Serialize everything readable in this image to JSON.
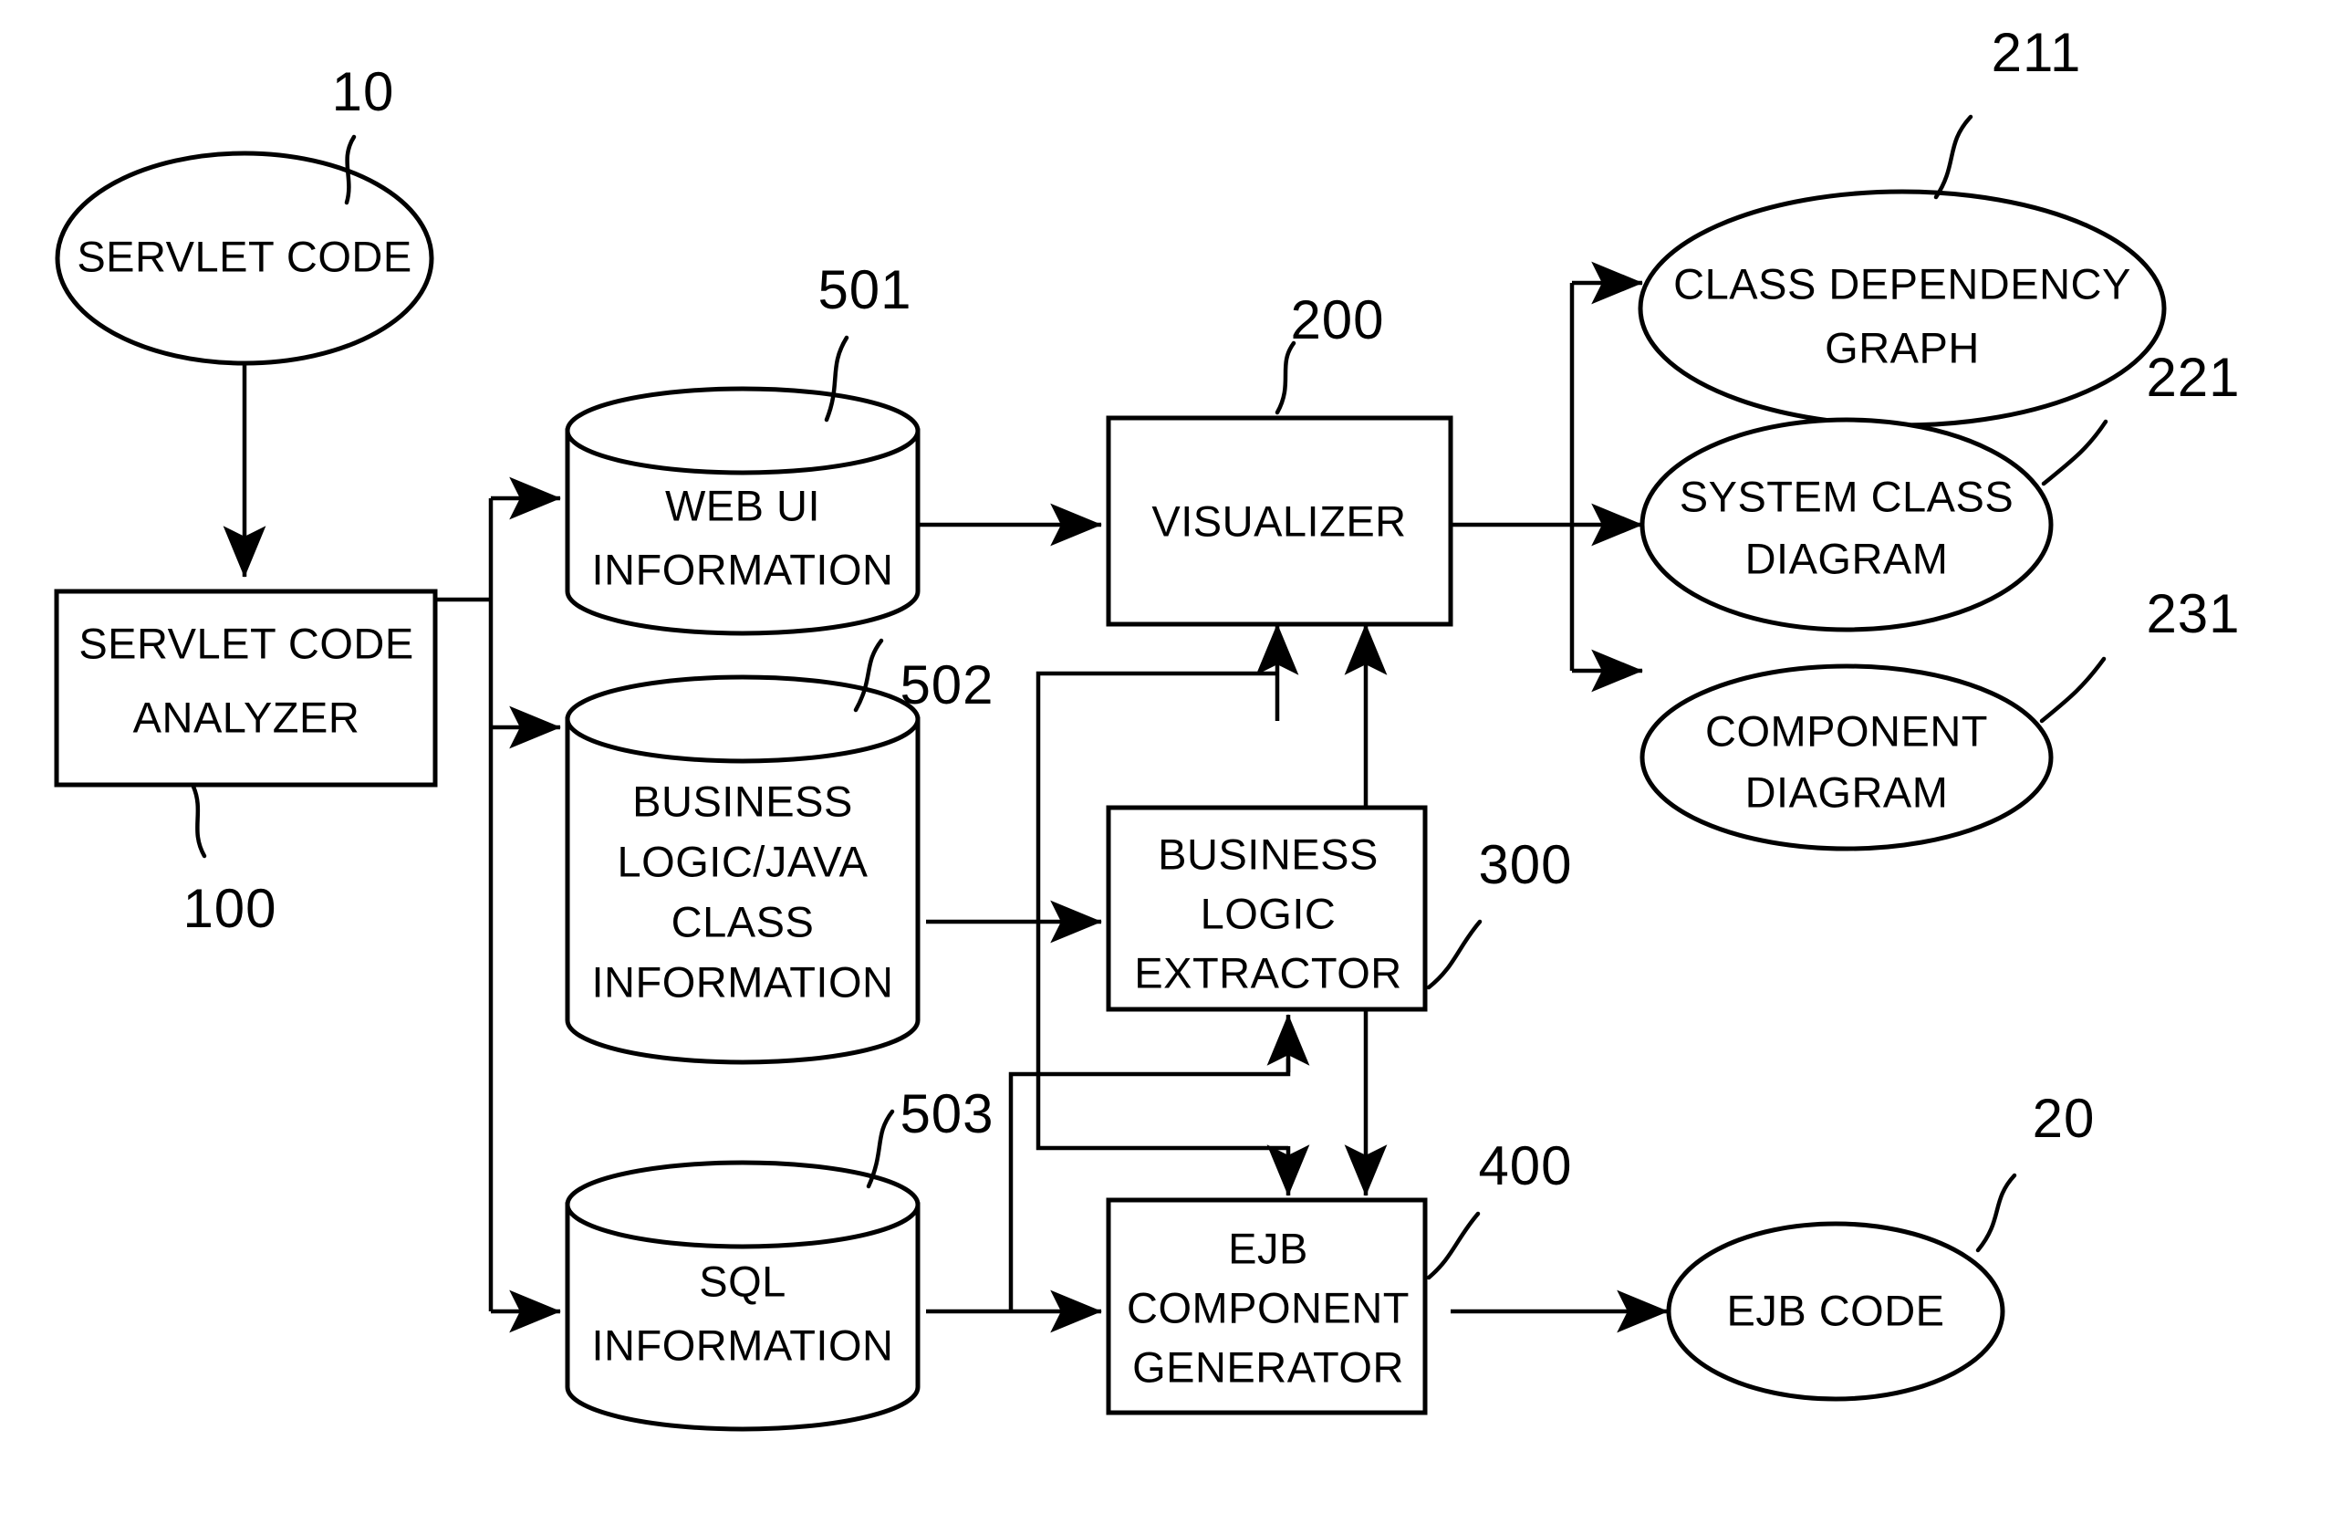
{
  "diagram": {
    "figure_kind": "patent-block-diagram",
    "nodes": {
      "servlet_code": {
        "label": "SERVLET CODE",
        "ref": "10",
        "shape": "ellipse"
      },
      "servlet_code_analyzer": {
        "label_line1": "SERVLET CODE",
        "label_line2": "ANALYZER",
        "ref": "100",
        "shape": "rectangle"
      },
      "web_ui_information": {
        "label_line1": "WEB UI",
        "label_line2": "INFORMATION",
        "ref": "501",
        "shape": "cylinder"
      },
      "business_logic_java_class_information": {
        "label_line1": "BUSINESS",
        "label_line2": "LOGIC/JAVA",
        "label_line3": "CLASS",
        "label_line4": "INFORMATION",
        "ref": "502",
        "shape": "cylinder"
      },
      "sql_information": {
        "label_line1": "SQL",
        "label_line2": "INFORMATION",
        "ref": "503",
        "shape": "cylinder"
      },
      "visualizer": {
        "label": "VISUALIZER",
        "ref": "200",
        "shape": "rectangle"
      },
      "business_logic_extractor": {
        "label_line1": "BUSINESS",
        "label_line2": "LOGIC",
        "label_line3": "EXTRACTOR",
        "ref": "300",
        "shape": "rectangle"
      },
      "ejb_component_generator": {
        "label_line1": "EJB",
        "label_line2": "COMPONENT",
        "label_line3": "GENERATOR",
        "ref": "400",
        "shape": "rectangle"
      },
      "class_dependency_graph": {
        "label_line1": "CLASS DEPENDENCY",
        "label_line2": "GRAPH",
        "ref": "211",
        "shape": "ellipse"
      },
      "system_class_diagram": {
        "label_line1": "SYSTEM CLASS",
        "label_line2": "DIAGRAM",
        "ref": "221",
        "shape": "ellipse"
      },
      "component_diagram": {
        "label_line1": "COMPONENT",
        "label_line2": "DIAGRAM",
        "ref": "231",
        "shape": "ellipse"
      },
      "ejb_code": {
        "label": "EJB CODE",
        "ref": "20",
        "shape": "ellipse"
      }
    },
    "edges": [
      {
        "from": "servlet_code",
        "to": "servlet_code_analyzer"
      },
      {
        "from": "servlet_code_analyzer",
        "to": "web_ui_information"
      },
      {
        "from": "servlet_code_analyzer",
        "to": "business_logic_java_class_information"
      },
      {
        "from": "servlet_code_analyzer",
        "to": "sql_information"
      },
      {
        "from": "web_ui_information",
        "to": "visualizer"
      },
      {
        "from": "business_logic_java_class_information",
        "to": "business_logic_extractor"
      },
      {
        "from": "business_logic_java_class_information",
        "to": "visualizer"
      },
      {
        "from": "sql_information",
        "to": "ejb_component_generator"
      },
      {
        "from": "sql_information",
        "to": "business_logic_extractor"
      },
      {
        "from": "sql_information",
        "to": "ejb_component_generator"
      },
      {
        "from": "business_logic_extractor",
        "to": "visualizer"
      },
      {
        "from": "business_logic_extractor",
        "to": "ejb_component_generator"
      },
      {
        "from": "visualizer",
        "to": "class_dependency_graph"
      },
      {
        "from": "visualizer",
        "to": "system_class_diagram"
      },
      {
        "from": "visualizer",
        "to": "component_diagram"
      },
      {
        "from": "ejb_component_generator",
        "to": "ejb_code"
      }
    ],
    "colors": {
      "line": "#000000",
      "fill": "#ffffff"
    }
  }
}
